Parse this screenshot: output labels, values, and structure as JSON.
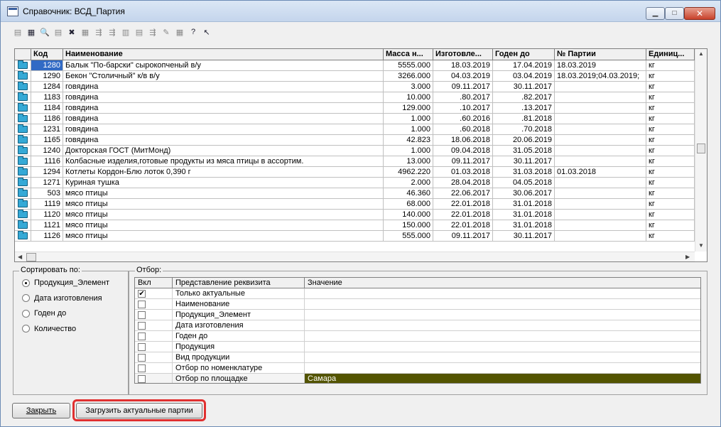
{
  "window": {
    "title": "Справочник: ВСД_Партия"
  },
  "grid": {
    "headers": [
      "Код",
      "Наименование",
      "Масса н...",
      "Изготовле...",
      "Годен до",
      "№ Партии",
      "Единиц..."
    ],
    "rows": [
      [
        "1280",
        "Балык \"По-барски\" сырокопченый в/у",
        "5555.000",
        "18.03.2019",
        "17.04.2019",
        "18.03.2019",
        "кг"
      ],
      [
        "1290",
        "Бекон \"Столичный\" к/в в/у",
        "3266.000",
        "04.03.2019",
        "03.04.2019",
        "18.03.2019;04.03.2019;",
        "кг"
      ],
      [
        "1284",
        "говядина",
        "3.000",
        "09.11.2017",
        "30.11.2017",
        "",
        "кг"
      ],
      [
        "1183",
        "говядина",
        "10.000",
        ".80.2017",
        ".82.2017",
        "",
        "кг"
      ],
      [
        "1184",
        "говядина",
        "129.000",
        ".10.2017",
        ".13.2017",
        "",
        "кг"
      ],
      [
        "1186",
        "говядина",
        "1.000",
        ".60.2016",
        ".81.2018",
        "",
        "кг"
      ],
      [
        "1231",
        "говядина",
        "1.000",
        ".60.2018",
        ".70.2018",
        "",
        "кг"
      ],
      [
        "1165",
        "говядина",
        "42.823",
        "18.06.2018",
        "20.06.2019",
        "",
        "кг"
      ],
      [
        "1240",
        "Докторская ГОСТ (МитМонд)",
        "1.000",
        "09.04.2018",
        "31.05.2018",
        "",
        "кг"
      ],
      [
        "1116",
        "Колбасные изделия,готовые продукты из мяса птицы в ассортим.",
        "13.000",
        "09.11.2017",
        "30.11.2017",
        "",
        "кг"
      ],
      [
        "1294",
        "Котлеты Кордон-Блю лоток 0,390 г",
        "4962.220",
        "01.03.2018",
        "31.03.2018",
        "01.03.2018",
        "кг"
      ],
      [
        "1271",
        "Куриная тушка",
        "2.000",
        "28.04.2018",
        "04.05.2018",
        "",
        "кг"
      ],
      [
        "503",
        "мясо птицы",
        "46.360",
        "22.06.2017",
        "30.06.2017",
        "",
        "кг"
      ],
      [
        "1119",
        "мясо птицы",
        "68.000",
        "22.01.2018",
        "31.01.2018",
        "",
        "кг"
      ],
      [
        "1120",
        "мясо птицы",
        "140.000",
        "22.01.2018",
        "31.01.2018",
        "",
        "кг"
      ],
      [
        "1121",
        "мясо птицы",
        "150.000",
        "22.01.2018",
        "31.01.2018",
        "",
        "кг"
      ],
      [
        "1126",
        "мясо птицы",
        "555.000",
        "09.11.2017",
        "30.11.2017",
        "",
        "кг"
      ]
    ]
  },
  "sort": {
    "label": "Сортировать по:",
    "options": [
      "Продукция_Элемент",
      "Дата изготовления",
      "Годен до",
      "Количество"
    ],
    "selected_index": 0
  },
  "filter": {
    "label": "Отбор:",
    "headers": [
      "Вкл",
      "Представление реквизита",
      "Значение"
    ],
    "rows": [
      {
        "checked": true,
        "name": "Только актуальные",
        "value": ""
      },
      {
        "checked": false,
        "name": "Наименование",
        "value": ""
      },
      {
        "checked": false,
        "name": "Продукция_Элемент",
        "value": ""
      },
      {
        "checked": false,
        "name": "Дата изготовления",
        "value": ""
      },
      {
        "checked": false,
        "name": "Годен до",
        "value": ""
      },
      {
        "checked": false,
        "name": "Продукция",
        "value": ""
      },
      {
        "checked": false,
        "name": "Вид продукции",
        "value": ""
      },
      {
        "checked": false,
        "name": "Отбор по номенклатуре",
        "value": ""
      },
      {
        "checked": false,
        "name": "Отбор по площадке",
        "value": "Самара"
      }
    ]
  },
  "buttons": {
    "close_label": "Закрыть",
    "load_label": "Загрузить актуальные партии"
  },
  "colors": {
    "selection": "#316ac5",
    "filter_value_bg": "#535400",
    "highlight": "#e03030"
  }
}
